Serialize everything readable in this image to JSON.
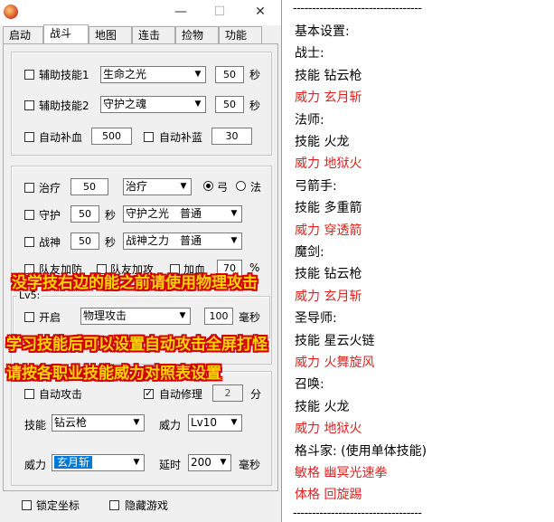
{
  "window": {
    "titlebar": {
      "minimize": "—",
      "maximize": "☐",
      "close": "✕"
    },
    "tabs": [
      "启动",
      "战斗",
      "地图",
      "连击",
      "捡物",
      "功能"
    ],
    "active_tab": "战斗"
  },
  "combat": {
    "assist1": {
      "label": "辅助技能1",
      "select": "生命之光",
      "value": "50",
      "unit": "秒"
    },
    "assist2": {
      "label": "辅助技能2",
      "select": "守护之魂",
      "value": "50",
      "unit": "秒"
    },
    "auto_hp": {
      "label": "自动补血",
      "value": "500"
    },
    "auto_mp": {
      "label": "自动补蓝",
      "value": "30"
    },
    "heal": {
      "label": "治疗",
      "value": "50",
      "select": "治疗",
      "radio1": "弓",
      "radio2": "法"
    },
    "guard": {
      "label": "守护",
      "value": "50",
      "unit": "秒",
      "select": "守护之光　普通"
    },
    "wargod": {
      "label": "战神",
      "value": "50",
      "unit": "秒",
      "select": "战神之力　普通"
    },
    "team_row": {
      "l1": "队友加防",
      "l2": "队友加攻",
      "l3": "加血",
      "value": "70",
      "unit": "%"
    },
    "lv5": {
      "title": "Lv5:",
      "label": "开启",
      "select": "物理攻击",
      "value": "100",
      "unit": "毫秒"
    },
    "auto_attack": {
      "label": "自动攻击"
    },
    "auto_repair": {
      "label": "自动修理",
      "value": "2",
      "unit": "分"
    },
    "skill": {
      "label": "技能",
      "select": "钻云枪"
    },
    "power": {
      "label": "威力",
      "select": "Lv10"
    },
    "power2": {
      "label": "威力",
      "select": "玄月斩"
    },
    "delay": {
      "label": "延时",
      "value": "200",
      "unit": "毫秒"
    }
  },
  "footer": {
    "lock": "锁定坐标",
    "hide": "隐藏游戏"
  },
  "overlays": [
    "没学技右边的能之前请使用物理攻击",
    "学习技能后可以设置自动攻击全屏打怪",
    "请按各职业技能威力对照表设置"
  ],
  "guide": {
    "divider": "----------------------------------",
    "lines": [
      {
        "text": "基本设置:",
        "red": false
      },
      {
        "text": "战士:",
        "red": false
      },
      {
        "text": "技能 钻云枪",
        "red": false
      },
      {
        "text": "威力 玄月斩",
        "red": true
      },
      {
        "text": "法师:",
        "red": false
      },
      {
        "text": "技能 火龙",
        "red": false
      },
      {
        "text": "威力 地狱火",
        "red": true
      },
      {
        "text": "弓箭手:",
        "red": false
      },
      {
        "text": "技能 多重箭",
        "red": false
      },
      {
        "text": "威力 穿透箭",
        "red": true
      },
      {
        "text": "魔剑:",
        "red": false
      },
      {
        "text": "技能 钻云枪",
        "red": false
      },
      {
        "text": "威力 玄月斩",
        "red": true
      },
      {
        "text": "圣导师:",
        "red": false
      },
      {
        "text": "技能 星云火链",
        "red": false
      },
      {
        "text": "威力 火舞旋风",
        "red": true
      },
      {
        "text": "召唤:",
        "red": false
      },
      {
        "text": "技能 火龙",
        "red": false
      },
      {
        "text": "威力 地狱火",
        "red": true
      },
      {
        "text": "格斗家: (使用单体技能)",
        "red": false
      },
      {
        "text": "敏格 幽冥光速拳",
        "red": true
      },
      {
        "text": "体格 回旋踢",
        "red": true
      }
    ]
  }
}
